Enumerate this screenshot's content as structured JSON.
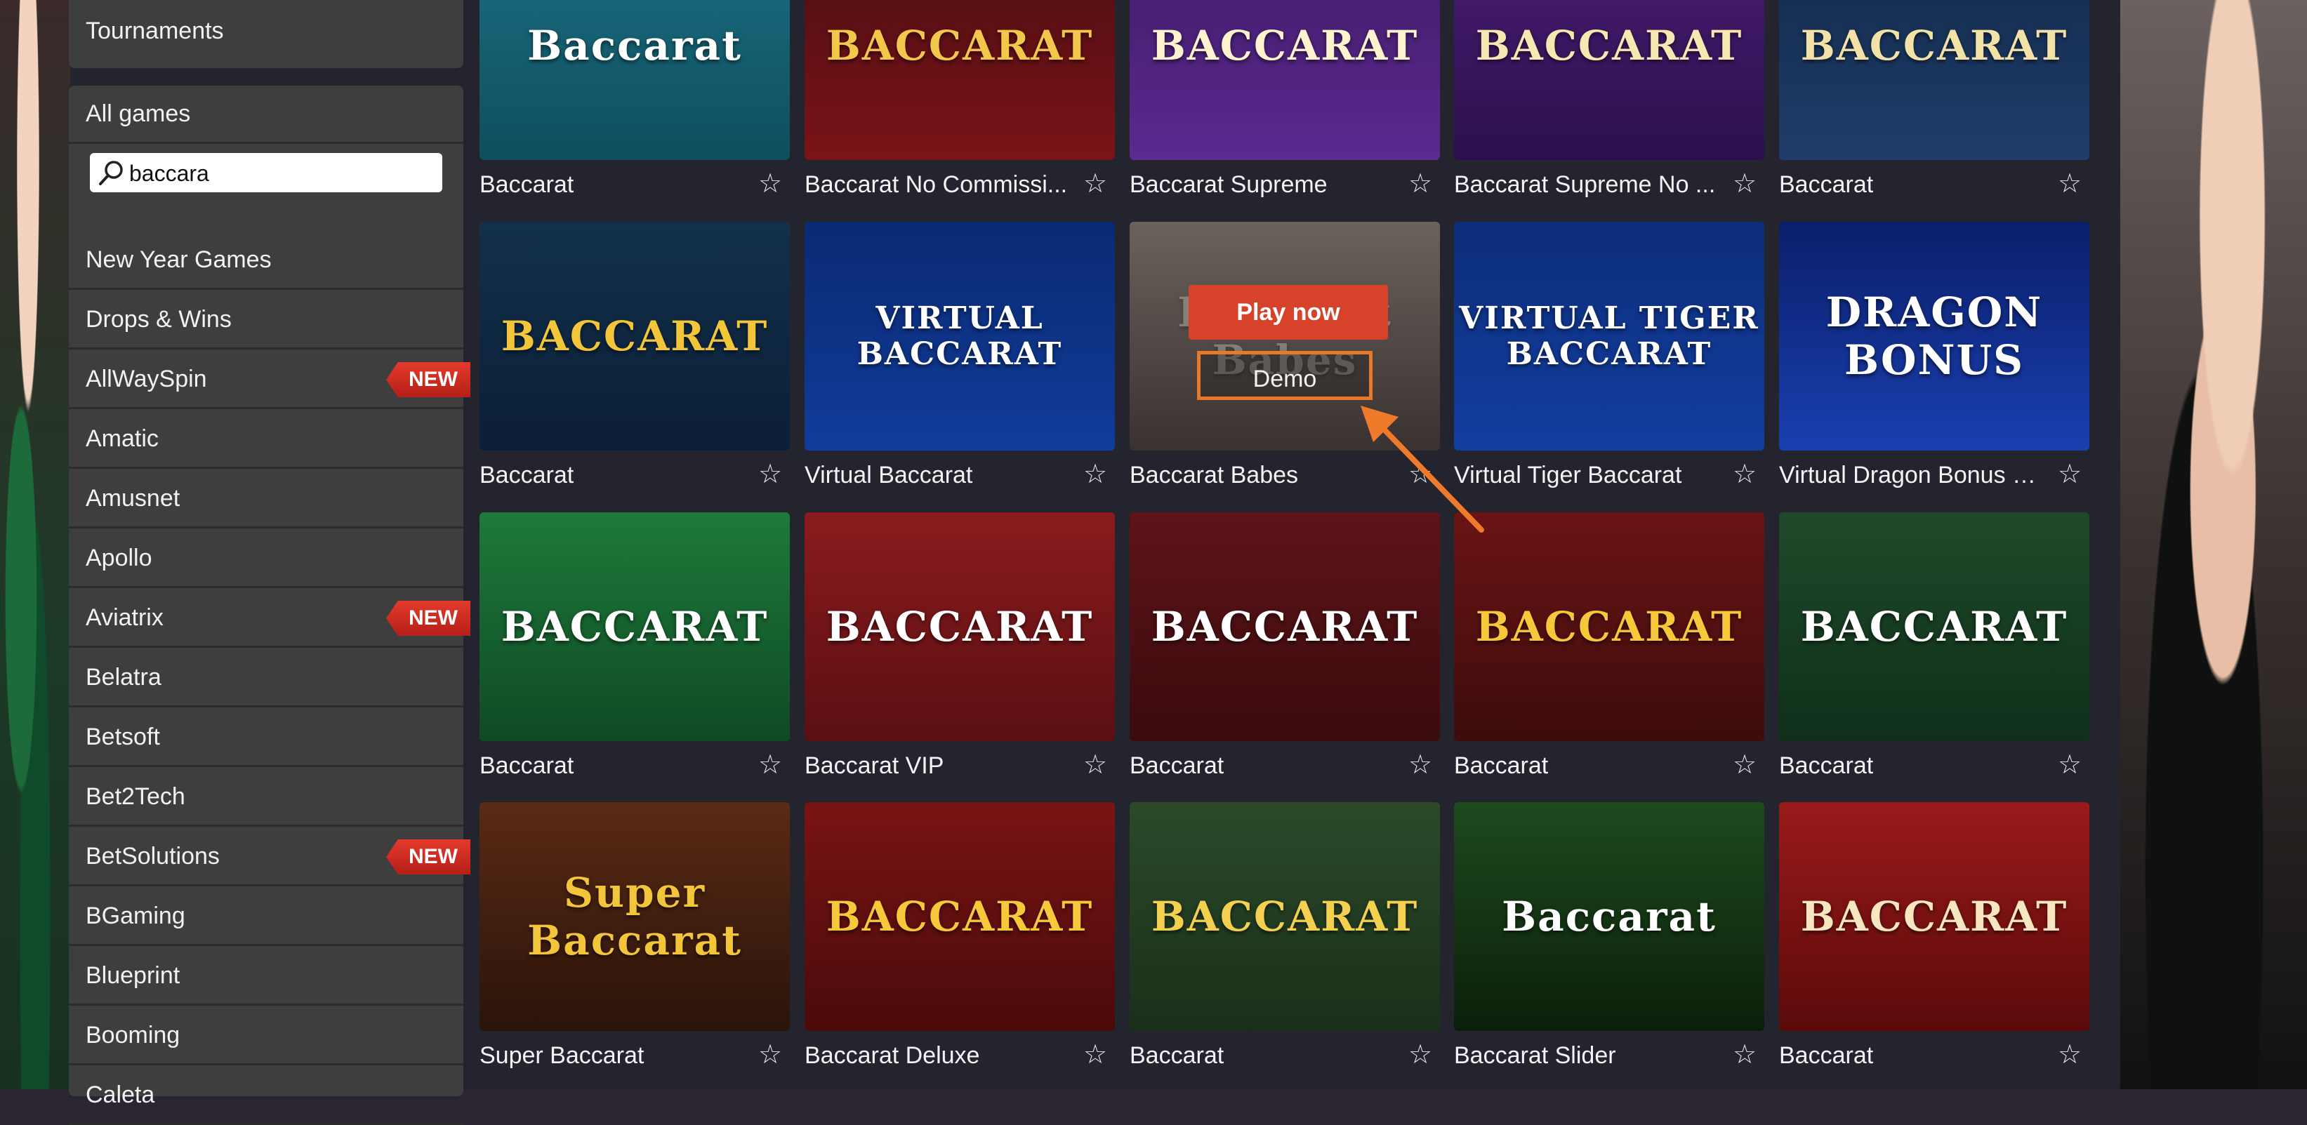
{
  "sidebar": {
    "top_item": "Tournaments",
    "all_games": "All games",
    "search": {
      "value": "baccara",
      "icon": "search-icon"
    },
    "items": [
      {
        "label": "New Year Games",
        "badge": ""
      },
      {
        "label": "Drops & Wins",
        "badge": ""
      },
      {
        "label": "AllWaySpin",
        "badge": "NEW"
      },
      {
        "label": "Amatic",
        "badge": ""
      },
      {
        "label": "Amusnet",
        "badge": ""
      },
      {
        "label": "Apollo",
        "badge": ""
      },
      {
        "label": "Aviatrix",
        "badge": "NEW"
      },
      {
        "label": "Belatra",
        "badge": ""
      },
      {
        "label": "Betsoft",
        "badge": ""
      },
      {
        "label": "Bet2Tech",
        "badge": ""
      },
      {
        "label": "BetSolutions",
        "badge": "NEW"
      },
      {
        "label": "BGaming",
        "badge": ""
      },
      {
        "label": "Blueprint",
        "badge": ""
      },
      {
        "label": "Booming",
        "badge": ""
      },
      {
        "label": "Caleta",
        "badge": ""
      }
    ]
  },
  "overlay": {
    "play_label": "Play now",
    "demo_label": "Demo"
  },
  "colors": {
    "accent": "#d7432a",
    "highlight": "#e67a2a",
    "badge": "#d32f26"
  },
  "games": [
    {
      "label": "Baccarat",
      "art": "Baccarat",
      "art_color": "#ffffff",
      "bg": "linear-gradient(180deg,#1a6f82,#0f4e5e)"
    },
    {
      "label": "Baccarat No Commissi...",
      "art": "BACCARAT",
      "art_color": "#f3c84a",
      "bg": "linear-gradient(180deg,#4a0d12,#7a1418)"
    },
    {
      "label": "Baccarat Supreme",
      "art": "BACCARAT",
      "art_color": "#fff3cf",
      "bg": "linear-gradient(180deg,#3d1a66,#5c2a90)"
    },
    {
      "label": "Baccarat Supreme No ...",
      "art": "BACCARAT",
      "art_color": "#f7e7b0",
      "bg": "linear-gradient(180deg,#4a1e74,#2c0f4c)"
    },
    {
      "label": "Baccarat",
      "art": "BACCARAT",
      "art_color": "#f2e2a8",
      "bg": "linear-gradient(180deg,#13294a,#1e3d6a)"
    },
    {
      "label": "Baccarat",
      "art": "BACCARAT",
      "art_color": "#f3c53a",
      "bg": "linear-gradient(180deg,#12304c,#0b1f36)"
    },
    {
      "label": "Virtual Baccarat",
      "art": "VIRTUAL BACCARAT",
      "art_color": "#ffffff",
      "bg": "linear-gradient(180deg,#0b2a73,#103c9a)"
    },
    {
      "label": "Baccarat Babes",
      "art": "Baccarat Babes",
      "art_color": "#b8b0a8",
      "bg": "linear-gradient(180deg,#6a625c,#3a3230)"
    },
    {
      "label": "Virtual Tiger Baccarat",
      "art": "VIRTUAL TIGER BACCARAT",
      "art_color": "#ffffff",
      "bg": "linear-gradient(180deg,#0d2d7a,#123ea0)"
    },
    {
      "label": "Virtual Dragon Bonus Ba...",
      "art": "DRAGON BONUS",
      "art_color": "#ffffff",
      "bg": "linear-gradient(180deg,#0a1f6a,#1a3fb0)"
    },
    {
      "label": "Baccarat",
      "art": "BACCARAT",
      "art_color": "#ffffff",
      "bg": "linear-gradient(180deg,#1e7a3a,#0f4a24)"
    },
    {
      "label": "Baccarat VIP",
      "art": "BACCARAT",
      "art_color": "#ffffff",
      "bg": "linear-gradient(180deg,#8a1b1e,#5a0f12)"
    },
    {
      "label": "Baccarat",
      "art": "BACCARAT",
      "art_color": "#ffffff",
      "bg": "linear-gradient(180deg,#5e1418,#3a0b0e)"
    },
    {
      "label": "Baccarat",
      "art": "BACCARAT",
      "art_color": "#f6c83a",
      "bg": "linear-gradient(180deg,#6a1414,#3d0c0c)"
    },
    {
      "label": "Baccarat",
      "art": "BACCARAT",
      "art_color": "#ffffff",
      "bg": "linear-gradient(180deg,#1e4a2a,#0f2f1a)"
    },
    {
      "label": "Super Baccarat",
      "art": "Super Baccarat",
      "art_color": "#f3c53a",
      "bg": "linear-gradient(180deg,#5a2a14,#2a140a)"
    },
    {
      "label": "Baccarat Deluxe",
      "art": "BACCARAT",
      "art_color": "#f6c83a",
      "bg": "linear-gradient(180deg,#7a1414,#4a0a0a)"
    },
    {
      "label": "Baccarat",
      "art": "BACCARAT",
      "art_color": "#f3d050",
      "bg": "linear-gradient(180deg,#2a4a2a,#1a2f1a)"
    },
    {
      "label": "Baccarat Slider",
      "art": "Baccarat",
      "art_color": "#ffffff",
      "bg": "linear-gradient(180deg,#1e4a1e,#0a1f0a)"
    },
    {
      "label": "Baccarat",
      "art": "BACCARAT",
      "art_color": "#f7e6c0",
      "bg": "linear-gradient(180deg,#9a1a1a,#5a0a0a)"
    }
  ]
}
